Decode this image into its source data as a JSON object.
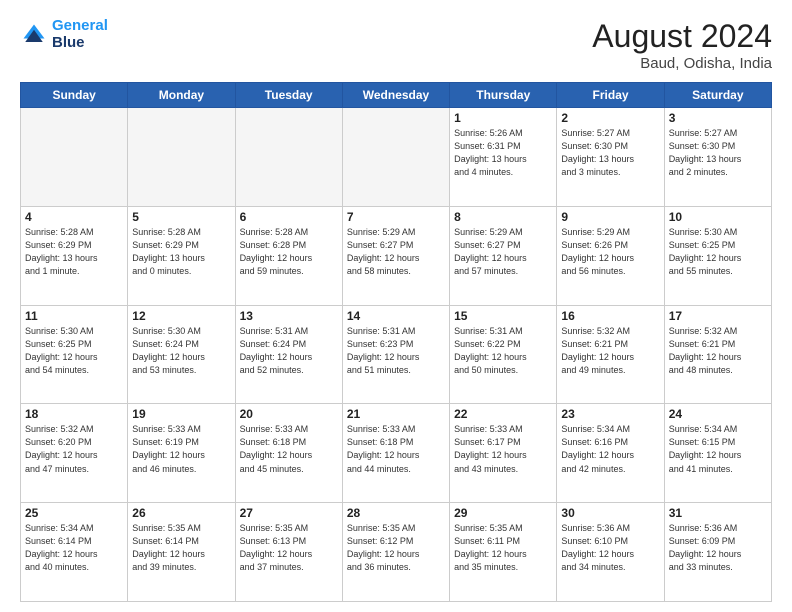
{
  "header": {
    "logo_line1": "General",
    "logo_line2": "Blue",
    "month": "August 2024",
    "location": "Baud, Odisha, India"
  },
  "weekdays": [
    "Sunday",
    "Monday",
    "Tuesday",
    "Wednesday",
    "Thursday",
    "Friday",
    "Saturday"
  ],
  "weeks": [
    [
      {
        "day": "",
        "info": "",
        "empty": true
      },
      {
        "day": "",
        "info": "",
        "empty": true
      },
      {
        "day": "",
        "info": "",
        "empty": true
      },
      {
        "day": "",
        "info": "",
        "empty": true
      },
      {
        "day": "1",
        "info": "Sunrise: 5:26 AM\nSunset: 6:31 PM\nDaylight: 13 hours\nand 4 minutes."
      },
      {
        "day": "2",
        "info": "Sunrise: 5:27 AM\nSunset: 6:30 PM\nDaylight: 13 hours\nand 3 minutes."
      },
      {
        "day": "3",
        "info": "Sunrise: 5:27 AM\nSunset: 6:30 PM\nDaylight: 13 hours\nand 2 minutes."
      }
    ],
    [
      {
        "day": "4",
        "info": "Sunrise: 5:28 AM\nSunset: 6:29 PM\nDaylight: 13 hours\nand 1 minute."
      },
      {
        "day": "5",
        "info": "Sunrise: 5:28 AM\nSunset: 6:29 PM\nDaylight: 13 hours\nand 0 minutes."
      },
      {
        "day": "6",
        "info": "Sunrise: 5:28 AM\nSunset: 6:28 PM\nDaylight: 12 hours\nand 59 minutes."
      },
      {
        "day": "7",
        "info": "Sunrise: 5:29 AM\nSunset: 6:27 PM\nDaylight: 12 hours\nand 58 minutes."
      },
      {
        "day": "8",
        "info": "Sunrise: 5:29 AM\nSunset: 6:27 PM\nDaylight: 12 hours\nand 57 minutes."
      },
      {
        "day": "9",
        "info": "Sunrise: 5:29 AM\nSunset: 6:26 PM\nDaylight: 12 hours\nand 56 minutes."
      },
      {
        "day": "10",
        "info": "Sunrise: 5:30 AM\nSunset: 6:25 PM\nDaylight: 12 hours\nand 55 minutes."
      }
    ],
    [
      {
        "day": "11",
        "info": "Sunrise: 5:30 AM\nSunset: 6:25 PM\nDaylight: 12 hours\nand 54 minutes."
      },
      {
        "day": "12",
        "info": "Sunrise: 5:30 AM\nSunset: 6:24 PM\nDaylight: 12 hours\nand 53 minutes."
      },
      {
        "day": "13",
        "info": "Sunrise: 5:31 AM\nSunset: 6:24 PM\nDaylight: 12 hours\nand 52 minutes."
      },
      {
        "day": "14",
        "info": "Sunrise: 5:31 AM\nSunset: 6:23 PM\nDaylight: 12 hours\nand 51 minutes."
      },
      {
        "day": "15",
        "info": "Sunrise: 5:31 AM\nSunset: 6:22 PM\nDaylight: 12 hours\nand 50 minutes."
      },
      {
        "day": "16",
        "info": "Sunrise: 5:32 AM\nSunset: 6:21 PM\nDaylight: 12 hours\nand 49 minutes."
      },
      {
        "day": "17",
        "info": "Sunrise: 5:32 AM\nSunset: 6:21 PM\nDaylight: 12 hours\nand 48 minutes."
      }
    ],
    [
      {
        "day": "18",
        "info": "Sunrise: 5:32 AM\nSunset: 6:20 PM\nDaylight: 12 hours\nand 47 minutes."
      },
      {
        "day": "19",
        "info": "Sunrise: 5:33 AM\nSunset: 6:19 PM\nDaylight: 12 hours\nand 46 minutes."
      },
      {
        "day": "20",
        "info": "Sunrise: 5:33 AM\nSunset: 6:18 PM\nDaylight: 12 hours\nand 45 minutes."
      },
      {
        "day": "21",
        "info": "Sunrise: 5:33 AM\nSunset: 6:18 PM\nDaylight: 12 hours\nand 44 minutes."
      },
      {
        "day": "22",
        "info": "Sunrise: 5:33 AM\nSunset: 6:17 PM\nDaylight: 12 hours\nand 43 minutes."
      },
      {
        "day": "23",
        "info": "Sunrise: 5:34 AM\nSunset: 6:16 PM\nDaylight: 12 hours\nand 42 minutes."
      },
      {
        "day": "24",
        "info": "Sunrise: 5:34 AM\nSunset: 6:15 PM\nDaylight: 12 hours\nand 41 minutes."
      }
    ],
    [
      {
        "day": "25",
        "info": "Sunrise: 5:34 AM\nSunset: 6:14 PM\nDaylight: 12 hours\nand 40 minutes."
      },
      {
        "day": "26",
        "info": "Sunrise: 5:35 AM\nSunset: 6:14 PM\nDaylight: 12 hours\nand 39 minutes."
      },
      {
        "day": "27",
        "info": "Sunrise: 5:35 AM\nSunset: 6:13 PM\nDaylight: 12 hours\nand 37 minutes."
      },
      {
        "day": "28",
        "info": "Sunrise: 5:35 AM\nSunset: 6:12 PM\nDaylight: 12 hours\nand 36 minutes."
      },
      {
        "day": "29",
        "info": "Sunrise: 5:35 AM\nSunset: 6:11 PM\nDaylight: 12 hours\nand 35 minutes."
      },
      {
        "day": "30",
        "info": "Sunrise: 5:36 AM\nSunset: 6:10 PM\nDaylight: 12 hours\nand 34 minutes."
      },
      {
        "day": "31",
        "info": "Sunrise: 5:36 AM\nSunset: 6:09 PM\nDaylight: 12 hours\nand 33 minutes."
      }
    ]
  ]
}
